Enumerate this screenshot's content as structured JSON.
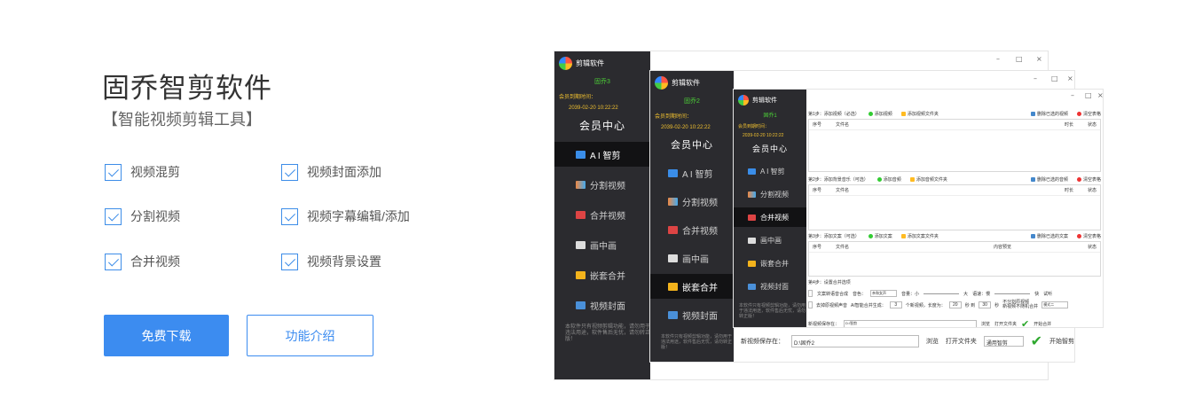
{
  "product": {
    "title": "固乔智剪软件",
    "subtitle": "【智能视频剪辑工具】"
  },
  "features": [
    "视频混剪",
    "视频封面添加",
    "分割视频",
    "视频字幕编辑/添加",
    "合并视频",
    "视频背景设置"
  ],
  "buttons": {
    "download": "免费下载",
    "intro": "功能介绍"
  },
  "screenshot": {
    "app_name": "剪辑软件",
    "window_controls": {
      "min": "–",
      "max": "□",
      "close": "×"
    },
    "vip_label": "会员到期时间：",
    "vip_date": "2039-02-20 10:22:22",
    "member_center": "会员中心",
    "users": [
      "固乔3",
      "固乔2",
      "固乔1"
    ],
    "nav": [
      "A I 智剪",
      "分割视频",
      "合并视频",
      "画中画",
      "嵌套合并",
      "视频封面"
    ],
    "note": "本软件只有视频剪辑功能，请勿用于违法用途，软件售后无忧，请勿转正版！",
    "main": {
      "step1": "第1步：添加视频（必选）",
      "step2": "第2步：添加背景音乐（可选）",
      "step3": "第3步：添加文案（可选）",
      "step4": "第4步：设置合并选项",
      "add_video": "添加视频",
      "add_video_folder": "添加视频文件夹",
      "delete_selected_video": "删除已选的视频",
      "add_music": "添加音频",
      "add_music_folder": "添加音频文件夹",
      "delete_selected_music": "删除已选的音频",
      "add_text": "添加文案",
      "add_text_folder": "添加文案文件夹",
      "delete_selected_text": "删除已选的文案",
      "clear_table": "清空表格",
      "col_no": "序号",
      "col_file": "文件名",
      "col_duration": "时长",
      "col_status": "状态",
      "col_content": "内容预览",
      "tts_option": "文案转语音合成",
      "voice": "音色：",
      "voice_value": "亲和女声",
      "volume": "音量：小",
      "volume_big": "大",
      "speed": "语速：慢",
      "speed_fast": "快",
      "listen": "试听",
      "orig_audio": "去掉原视频声音",
      "ai_gen": "AI智能合并生成：",
      "ai_count": "3",
      "new_video_len": "个新视频，长度为：",
      "len_from": "20",
      "len_to": "30",
      "sec_to": "秒 到",
      "sec": "秒",
      "no_repeat": "不分割原视频",
      "new_audio": "新视频不随机合并",
      "mode": "模式二",
      "save_label": "新视频保存在：",
      "save_path_1": "D:\\智剪",
      "save_path_2": "D:\\固乔2",
      "browse": "浏览",
      "open_folder": "打开文件夹",
      "mode_select": "通用智剪",
      "start": "开始合并",
      "start_smart": "开始智剪"
    }
  },
  "colors": {
    "accent": "#3c8cf0",
    "sidebar": "#2b2b2f",
    "user_green": "#4cd137",
    "vip_gold": "#f0c030"
  }
}
